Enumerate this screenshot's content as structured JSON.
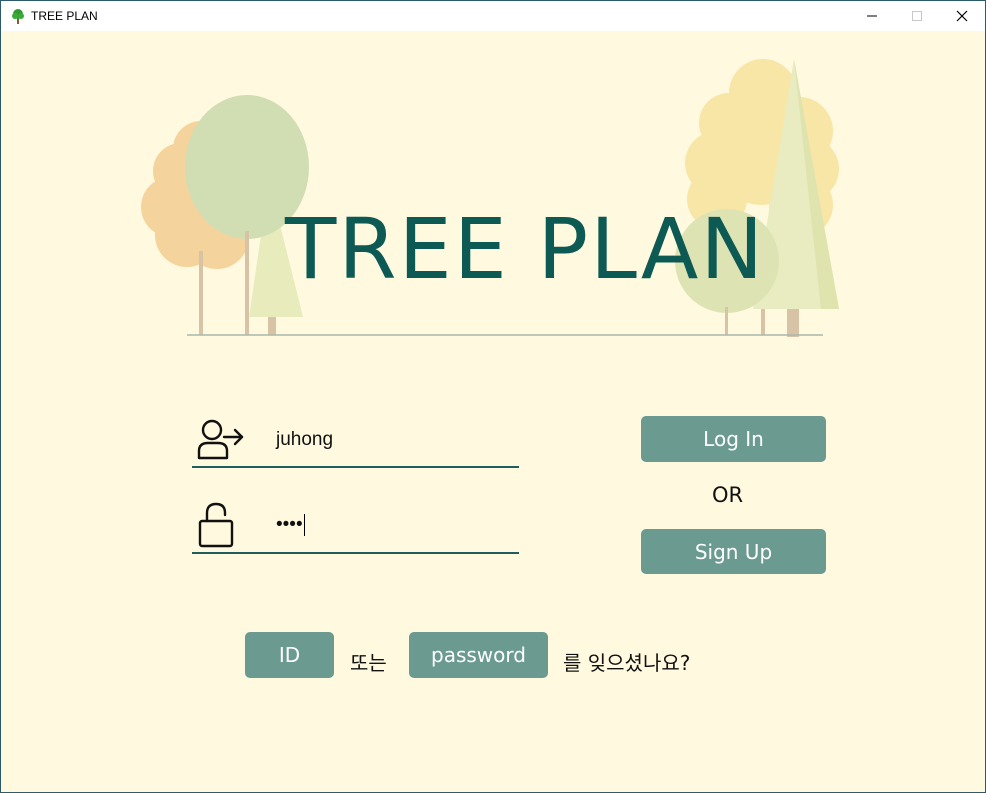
{
  "window": {
    "title": "TREE PLAN",
    "minimize_icon": "minimize-icon",
    "maximize_icon": "maximize-icon",
    "close_icon": "close-icon"
  },
  "hero": {
    "title": "TREE PLAN"
  },
  "login": {
    "username_icon": "user-arrow-icon",
    "username_value": "juhong",
    "password_icon": "unlock-icon",
    "password_value": "••••",
    "login_label": "Log In",
    "or_label": "OR",
    "signup_label": "Sign Up"
  },
  "recovery": {
    "id_label": "ID",
    "connector": "또는",
    "password_label": "password",
    "suffix": "를 잊으셨나요?"
  },
  "colors": {
    "background": "#fef9df",
    "title": "#0d5a55",
    "button": "#6b9a91",
    "underline": "#1f5e5d"
  }
}
